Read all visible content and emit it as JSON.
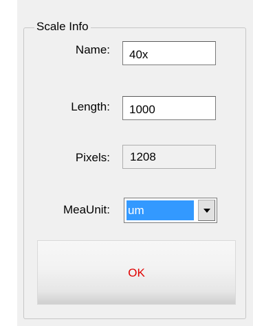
{
  "groupbox": {
    "title": "Scale Info"
  },
  "fields": {
    "name": {
      "label": "Name:",
      "value": "40x"
    },
    "length": {
      "label": "Length:",
      "value": "1000"
    },
    "pixels": {
      "label": "Pixels:",
      "value": "1208"
    },
    "mea_unit": {
      "label": "MeaUnit:",
      "value": "um"
    }
  },
  "actions": {
    "ok_label": "OK"
  },
  "colors": {
    "ok_text": "#e00000",
    "selection": "#3399ff",
    "panel_bg": "#f0f0f0"
  },
  "icons": {
    "combo_arrow": "chevron-down-icon"
  }
}
